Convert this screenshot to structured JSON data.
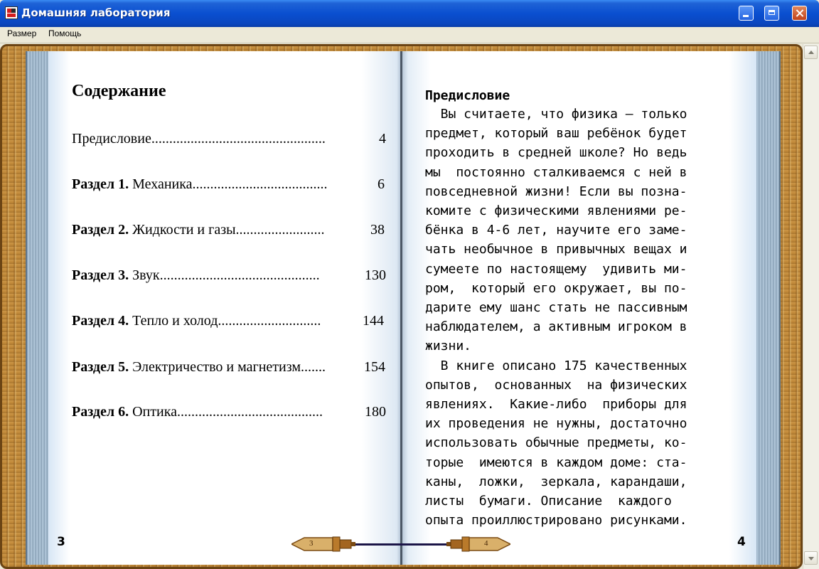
{
  "window": {
    "title": "Домашняя лаборатория"
  },
  "menu": {
    "items": [
      "Размер",
      "Помощь"
    ]
  },
  "left_page": {
    "heading": "Содержание",
    "toc": [
      {
        "prefix": "",
        "text": "Предисловие.................................................",
        "page": "4"
      },
      {
        "prefix": "Раздел 1.",
        "text": " Механика......................................",
        "page": "6"
      },
      {
        "prefix": "Раздел 2.",
        "text": " Жидкости и газы.........................",
        "page": "38"
      },
      {
        "prefix": "Раздел 3.",
        "text": " Звук.............................................",
        "page": "130"
      },
      {
        "prefix": "Раздел 4.",
        "text": " Тепло и холод.............................",
        "page": "144"
      },
      {
        "prefix": "Раздел 5.",
        "text": " Электричество и магнетизм.......",
        "page": "154"
      },
      {
        "prefix": "Раздел 6.",
        "text": " Оптика.........................................",
        "page": "180"
      }
    ],
    "page_number": "3"
  },
  "right_page": {
    "heading": "Предисловие",
    "lines": [
      "  Вы считаете, что физика – только",
      "предмет, который ваш ребёнок будет",
      "проходить в средней школе? Но ведь",
      "мы  постоянно сталкиваемся с ней в",
      "повседневной жизни! Если вы позна-",
      "комите с физическими явлениями ре-",
      "бёнка в 4-6 лет, научите его заме-",
      "чать необычное в привычных вещах и",
      "сумеете по настоящему  удивить ми-",
      "ром,  который его окружает, вы по-",
      "дарите ему шанс стать не пассивным",
      "наблюдателем, а активным игроком в",
      "жизни.",
      "  В книге описано 175 качественных",
      "опытов,  основанных  на физических",
      "явлениях.  Какие-либо  приборы для",
      "их проведения не нужны, достаточно",
      "использовать обычные предметы, ко-",
      "торые  имеются в каждом доме: ста-",
      "каны,  ложки,  зеркала, карандаши,",
      "листы  бумаги. Описание  каждого",
      "опыта проиллюстрировано рисунками."
    ],
    "page_number": "4"
  },
  "navigation": {
    "prev_page": "3",
    "next_page": "4"
  },
  "colors": {
    "titlebar": "#0a4fd0",
    "wood": "#c28a3a",
    "page": "#ffffff",
    "page_edge": "#8fa8bc"
  }
}
